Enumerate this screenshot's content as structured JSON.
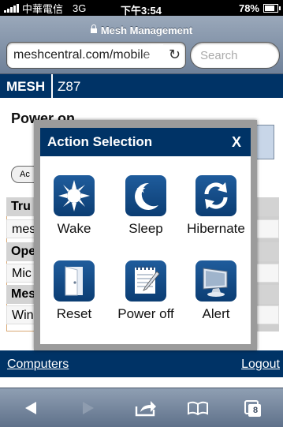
{
  "status_bar": {
    "carrier": "中華電信",
    "network": "3G",
    "time": "下午3:54",
    "battery_pct": "78%",
    "battery_level": 0.78
  },
  "browser": {
    "page_title": "Mesh Management",
    "url": "meshcentral.com/mobile",
    "search_placeholder": "Search"
  },
  "page": {
    "logo": "MESH",
    "device_name": "Z87",
    "power_title": "Power on",
    "action_button": "Ac",
    "table_rows": [
      {
        "kind": "header",
        "text": "Tru"
      },
      {
        "kind": "value",
        "text": "mes"
      },
      {
        "kind": "header",
        "text": "Ope"
      },
      {
        "kind": "value",
        "text": "Mic"
      },
      {
        "kind": "header",
        "text": "Mes"
      },
      {
        "kind": "value",
        "text": "Win"
      }
    ],
    "footer": {
      "left_link": "Computers",
      "right_link": "Logout"
    }
  },
  "dialog": {
    "title": "Action Selection",
    "close": "X",
    "actions": [
      {
        "label": "Wake",
        "icon": "sun-icon"
      },
      {
        "label": "Sleep",
        "icon": "moon-icon"
      },
      {
        "label": "Hibernate",
        "icon": "cycle-icon"
      },
      {
        "label": "Reset",
        "icon": "door-icon"
      },
      {
        "label": "Power off",
        "icon": "notepad-icon"
      },
      {
        "label": "Alert",
        "icon": "monitor-icon"
      }
    ]
  },
  "toolbar": {
    "tabs_count": "8"
  }
}
